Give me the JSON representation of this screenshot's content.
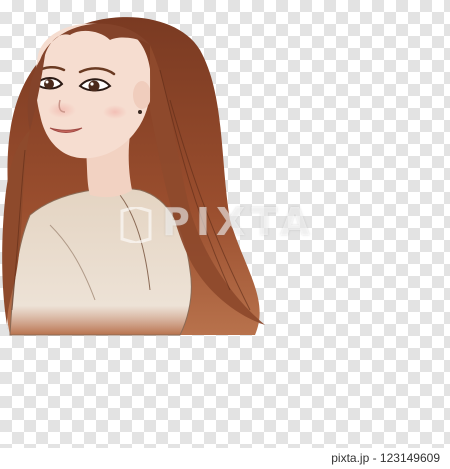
{
  "image": {
    "subject": "woman-portrait-icon",
    "background_pattern": "checkerboard",
    "colors": {
      "hair": "#8a4528",
      "skin": "#f6ddd0",
      "shirt": "#e7d9c8",
      "checker_light": "#ffffff",
      "checker_dark": "#e3e3e3"
    }
  },
  "watermark": {
    "text": "PIXTA"
  },
  "footer": {
    "caption": "pixta.jp - 123149609"
  }
}
